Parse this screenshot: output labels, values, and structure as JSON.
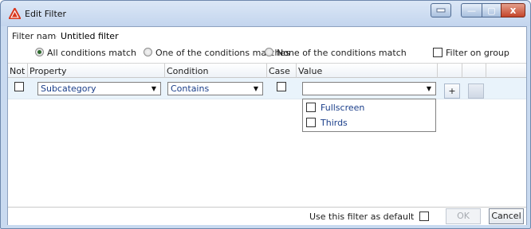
{
  "window": {
    "title": "Edit Filter",
    "icon": "app-warning-triangle-icon",
    "controls": {
      "restore_icon": "restore-icon",
      "minimize_glyph": "—",
      "maximize_glyph": "▢",
      "close_glyph": "x"
    }
  },
  "filter": {
    "name_label": "Filter name:",
    "name_value": "Untitled filter"
  },
  "match_options": [
    {
      "label": "All conditions match",
      "selected": true
    },
    {
      "label": "One of the conditions matches",
      "selected": false
    },
    {
      "label": "None of the conditions match",
      "selected": false
    }
  ],
  "filter_on_group": {
    "label": "Filter on group",
    "checked": false
  },
  "grid": {
    "columns": [
      "Not",
      "Property",
      "Condition",
      "Case",
      "Value"
    ],
    "rows": [
      {
        "not": false,
        "property": "Subcategory",
        "condition": "Contains",
        "case": false,
        "value": "",
        "add_label": "+"
      }
    ]
  },
  "value_dropdown": {
    "options": [
      {
        "label": "Fullscreen",
        "checked": false
      },
      {
        "label": "Thirds",
        "checked": false
      }
    ]
  },
  "footer": {
    "default_label": "Use this filter as default",
    "default_checked": false,
    "ok_label": "OK",
    "cancel_label": "Cancel"
  },
  "colors": {
    "accent_text": "#1a3e8a",
    "selected_row": "#e9f3fb",
    "title_bar": "#c3d5ee",
    "close_button": "#c4452a"
  }
}
